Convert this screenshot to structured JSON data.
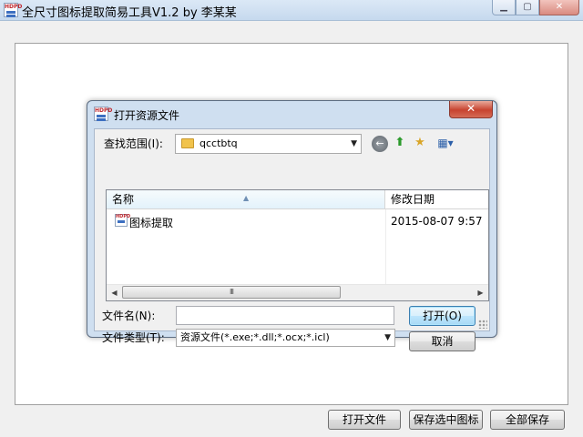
{
  "window": {
    "title": "全尺寸图标提取简易工具V1.2 by 李某某",
    "app_icon_text": "HDPD",
    "minimize_glyph": "▁",
    "maximize_glyph": "▢",
    "close_glyph": "✕"
  },
  "dialog": {
    "title": "打开资源文件",
    "close_glyph": "✕",
    "look_in_label": "查找范围(I):",
    "look_in_value": "qcctbtq",
    "dropdown_arrow": "▼",
    "toolbar": {
      "back_icon": "arrow-left",
      "up_icon": "up-folder",
      "new_folder_icon": "new-folder",
      "view_menu_icon": "view-menu"
    },
    "columns": {
      "name": "名称",
      "date_modified": "修改日期"
    },
    "files": [
      {
        "name": "图标提取",
        "date": "2015-08-07 9:57"
      }
    ],
    "scroll": {
      "left": "◀",
      "right": "▶",
      "thumb": "III"
    },
    "filename_label": "文件名(N):",
    "filename_value": "",
    "filetype_label": "文件类型(T):",
    "filetype_value": "资源文件(*.exe;*.dll;*.ocx;*.icl)",
    "open_button": "打开(O)",
    "cancel_button": "取消"
  },
  "bottom_buttons": {
    "open_file": "打开文件",
    "save_selected": "保存选中图标",
    "save_all": "全部保存"
  },
  "colors": {
    "titlebar": "#c6d9ee",
    "dialog_frame": "#cfdff0",
    "close_red": "#c7432f",
    "selection_blue": "#3c7fb1"
  }
}
